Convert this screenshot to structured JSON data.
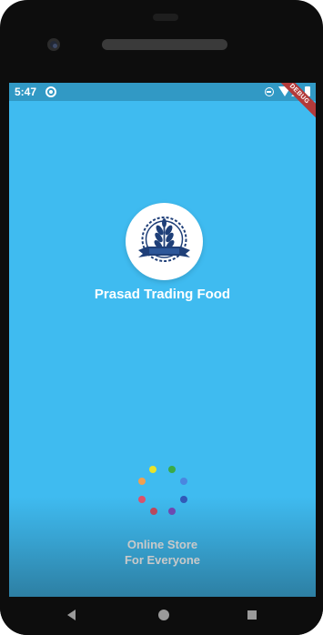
{
  "status_bar": {
    "time": "5:47",
    "debug_label": "DEBUG"
  },
  "splash": {
    "app_title": "Prasad Trading Food",
    "tagline_line1": "Online Store",
    "tagline_line2": "For Everyone",
    "loading_indicator": "colored-dots-spinner"
  },
  "colors": {
    "background": "#3fbbf0",
    "status_bar": "#3199c5",
    "logo_dark_blue": "#1f3f78",
    "debug_ribbon": "#b33a3a"
  },
  "icons": [
    "wheat-logo-icon",
    "sync-icon",
    "dnd-icon",
    "wifi-icon",
    "signal-icon",
    "battery-icon",
    "back-icon",
    "home-icon",
    "recents-icon"
  ],
  "nav_bar": {
    "buttons": [
      "back",
      "home",
      "recents"
    ]
  }
}
